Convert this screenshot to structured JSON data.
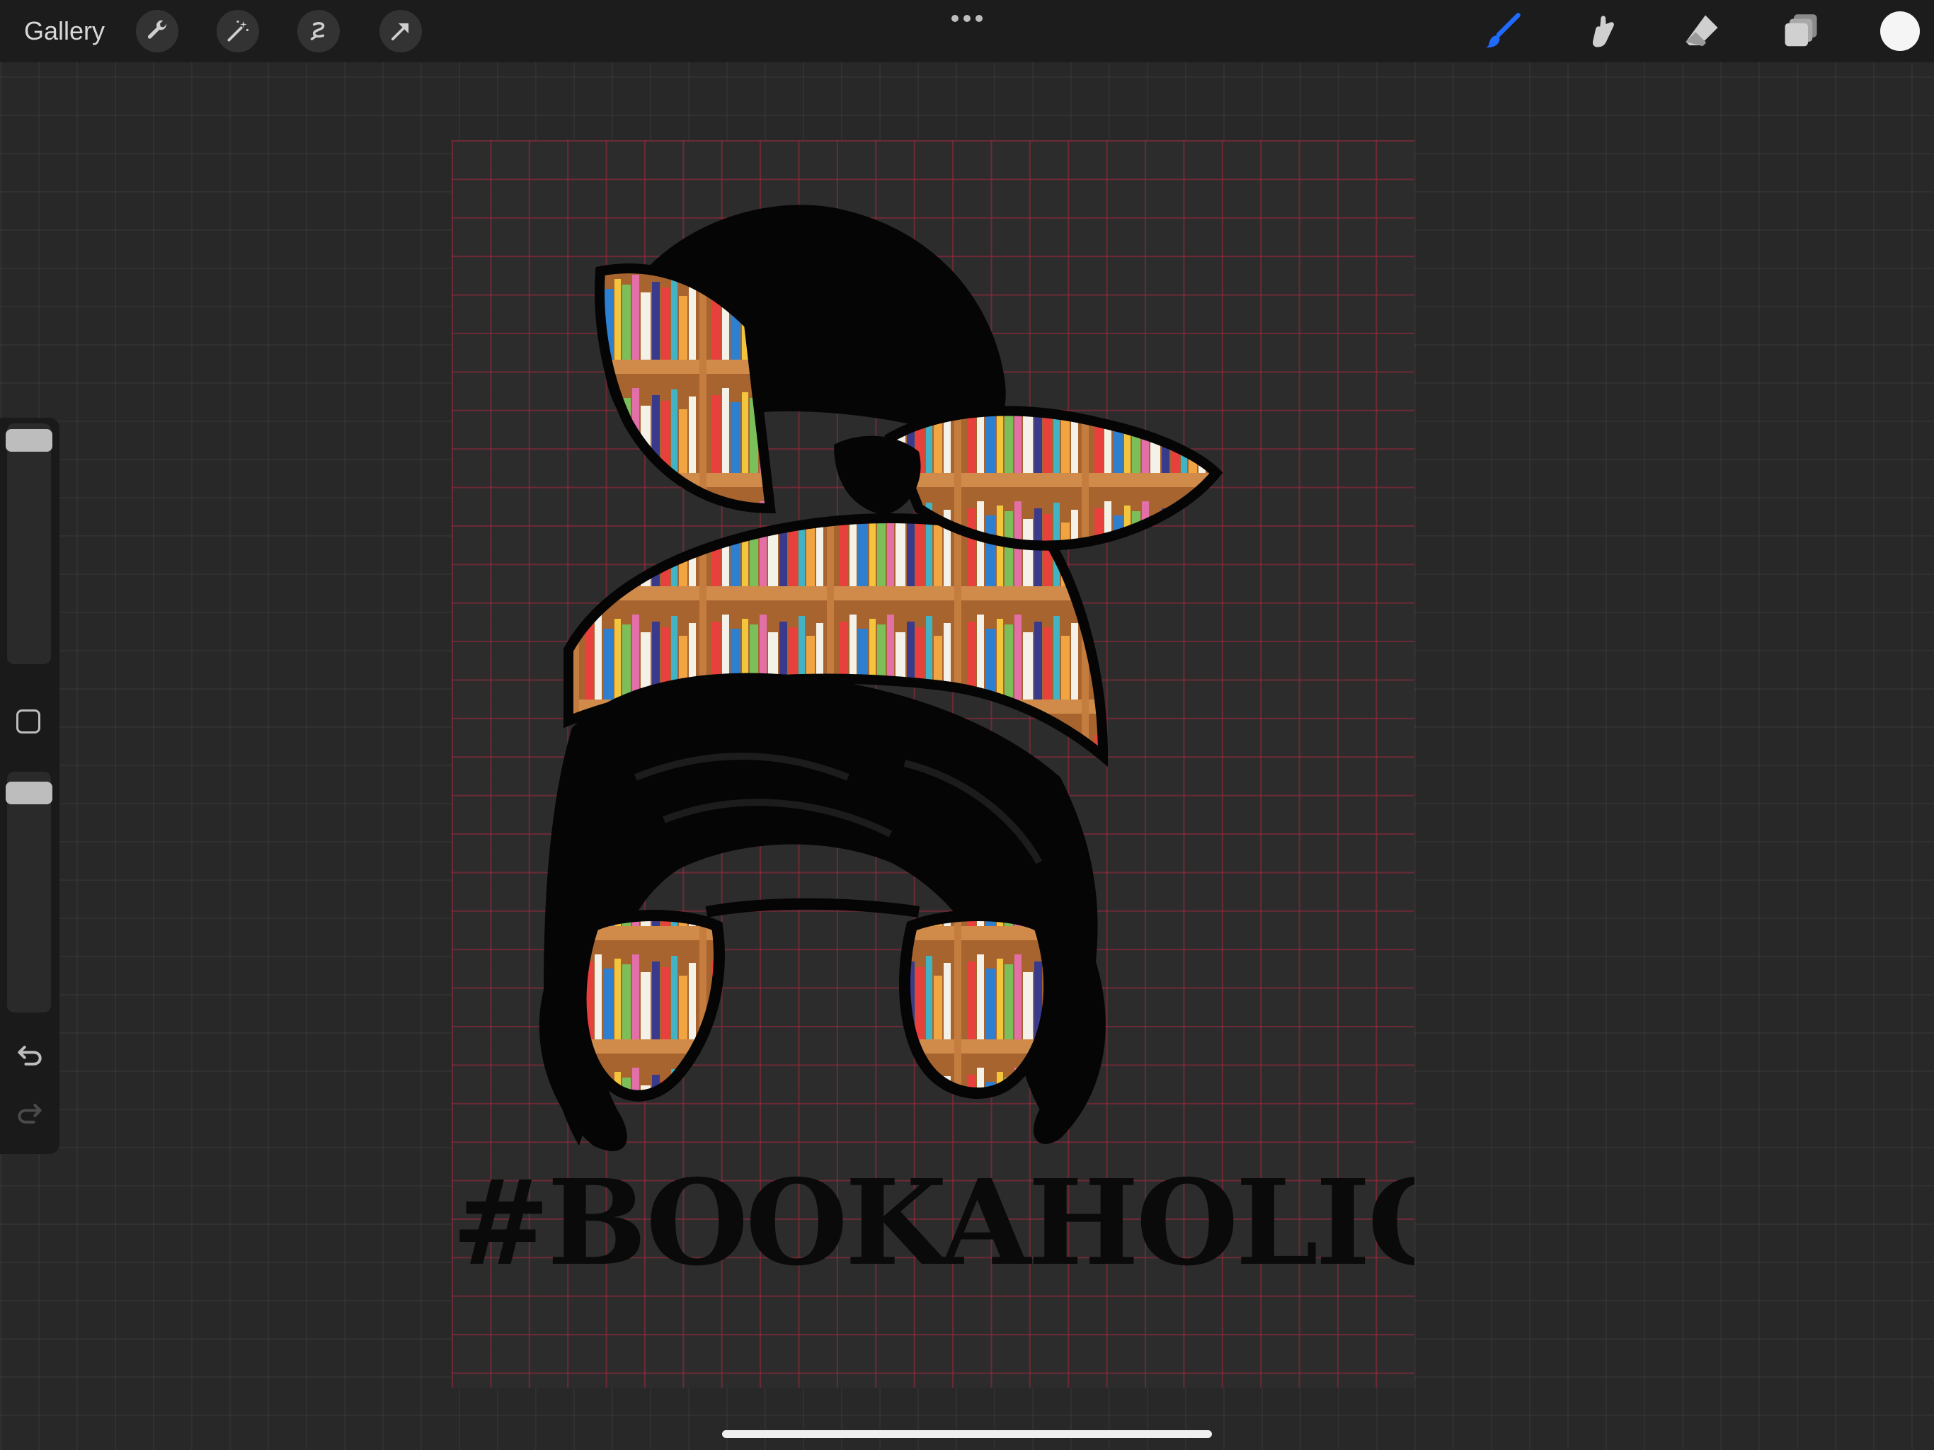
{
  "toolbar": {
    "gallery_label": "Gallery",
    "left_tools": [
      "wrench-icon",
      "magic-wand-icon",
      "selection-icon",
      "transform-arrow-icon"
    ],
    "right_tools": [
      "brush-icon",
      "smudge-icon",
      "eraser-icon",
      "layers-icon"
    ],
    "active_tool": "brush",
    "accent_color": "#1f6bff",
    "current_color": "#f5f5f5"
  },
  "sidebar": {
    "brush_size_slider": {
      "label": "Brush size",
      "value": 1.0
    },
    "opacity_slider": {
      "label": "Opacity",
      "value": 1.0
    },
    "icons": [
      "modify-square-icon",
      "undo-icon",
      "redo-icon"
    ]
  },
  "canvas": {
    "artwork_text": "#BOOKAHOLIC",
    "artwork_subject": "messy-bun woman silhouette with bookshelf-filled bandana and aviator sunglasses",
    "grid_color": "#8f2a3a"
  }
}
